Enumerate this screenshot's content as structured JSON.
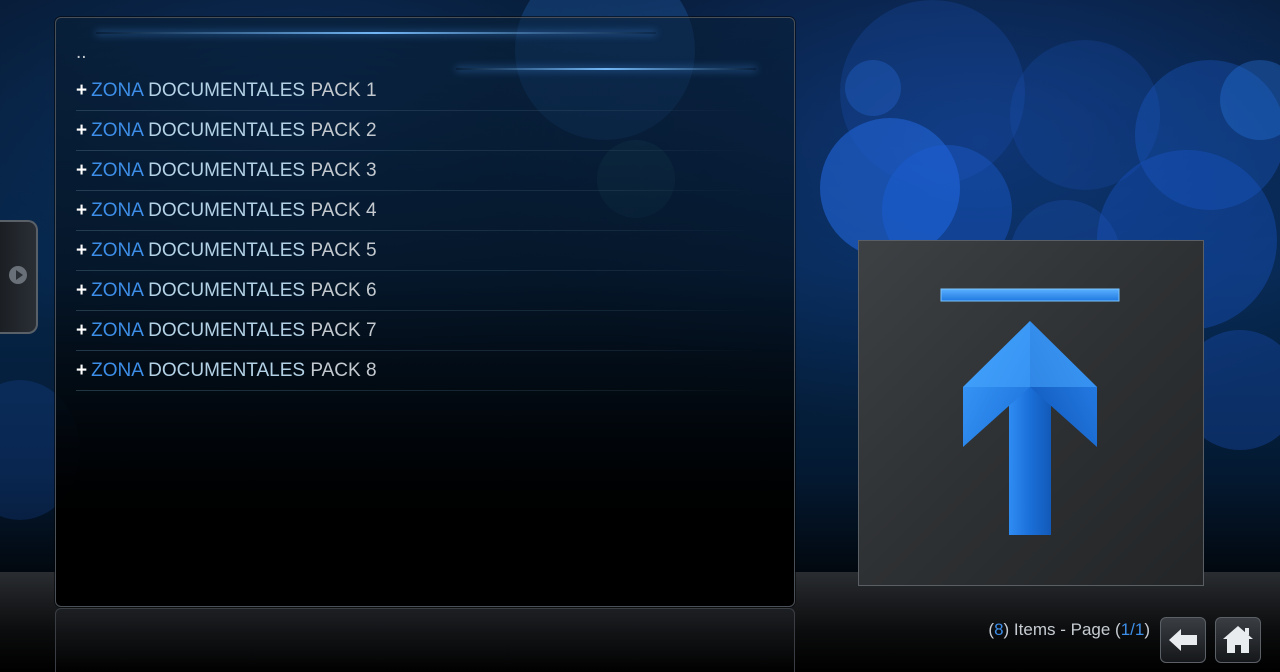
{
  "list": {
    "up_label": "..",
    "items": [
      {
        "prefix": "+",
        "a": "ZONA",
        "b": "DOCUMENTALES",
        "c": "PACK 1"
      },
      {
        "prefix": "+",
        "a": "ZONA",
        "b": "DOCUMENTALES",
        "c": "PACK 2"
      },
      {
        "prefix": "+",
        "a": "ZONA",
        "b": "DOCUMENTALES",
        "c": "PACK 3"
      },
      {
        "prefix": "+",
        "a": "ZONA",
        "b": "DOCUMENTALES",
        "c": "PACK 4"
      },
      {
        "prefix": "+",
        "a": "ZONA",
        "b": "DOCUMENTALES",
        "c": "PACK 5"
      },
      {
        "prefix": "+",
        "a": "ZONA",
        "b": "DOCUMENTALES",
        "c": "PACK 6"
      },
      {
        "prefix": "+",
        "a": "ZONA",
        "b": "DOCUMENTALES",
        "c": "PACK 7"
      },
      {
        "prefix": "+",
        "a": "ZONA",
        "b": "DOCUMENTALES",
        "c": "PACK 8"
      }
    ]
  },
  "footer": {
    "open_paren": "(",
    "item_count": "8",
    "items_page_text": ") Items - Page (",
    "page": "1/1",
    "close_paren": ")"
  },
  "icons": {
    "side_tab": "play-icon",
    "thumbnail": "parent-folder-up-arrow-icon",
    "back": "back-arrow-icon",
    "home": "home-icon"
  },
  "colors": {
    "accent_blue": "#3d8ee8",
    "light_blue_text": "#b4d2e6",
    "grey_text": "#c3c9ce"
  }
}
